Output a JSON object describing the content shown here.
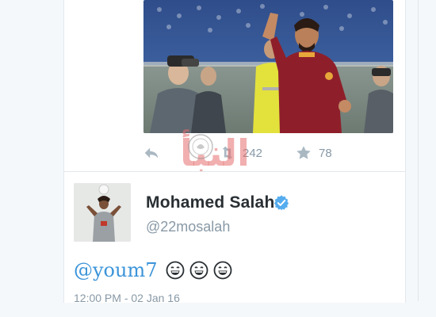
{
  "tweet": {
    "stats": {
      "retweets": "242",
      "favorites": "78"
    }
  },
  "next_tweet": {
    "display_name": "Mohamed Salah",
    "handle": "@22mosalah",
    "mention": "@youm7",
    "emoji_count": 3,
    "timestamp": "12:00 PM - 02 Jan 16"
  },
  "watermark": {
    "text": "النبأ",
    "seal_text": "ELNABA AL WATANI"
  },
  "icons": {
    "reply": "reply-icon",
    "retweet": "retweet-icon",
    "favorite": "star-icon",
    "verified": "verified-badge-icon",
    "emoji": "grinning-face-icon"
  },
  "colors": {
    "link": "#3b94d9",
    "muted": "#8899a6",
    "name": "#292f33",
    "verified": "#55acee",
    "watermark": "#e66e6e"
  }
}
